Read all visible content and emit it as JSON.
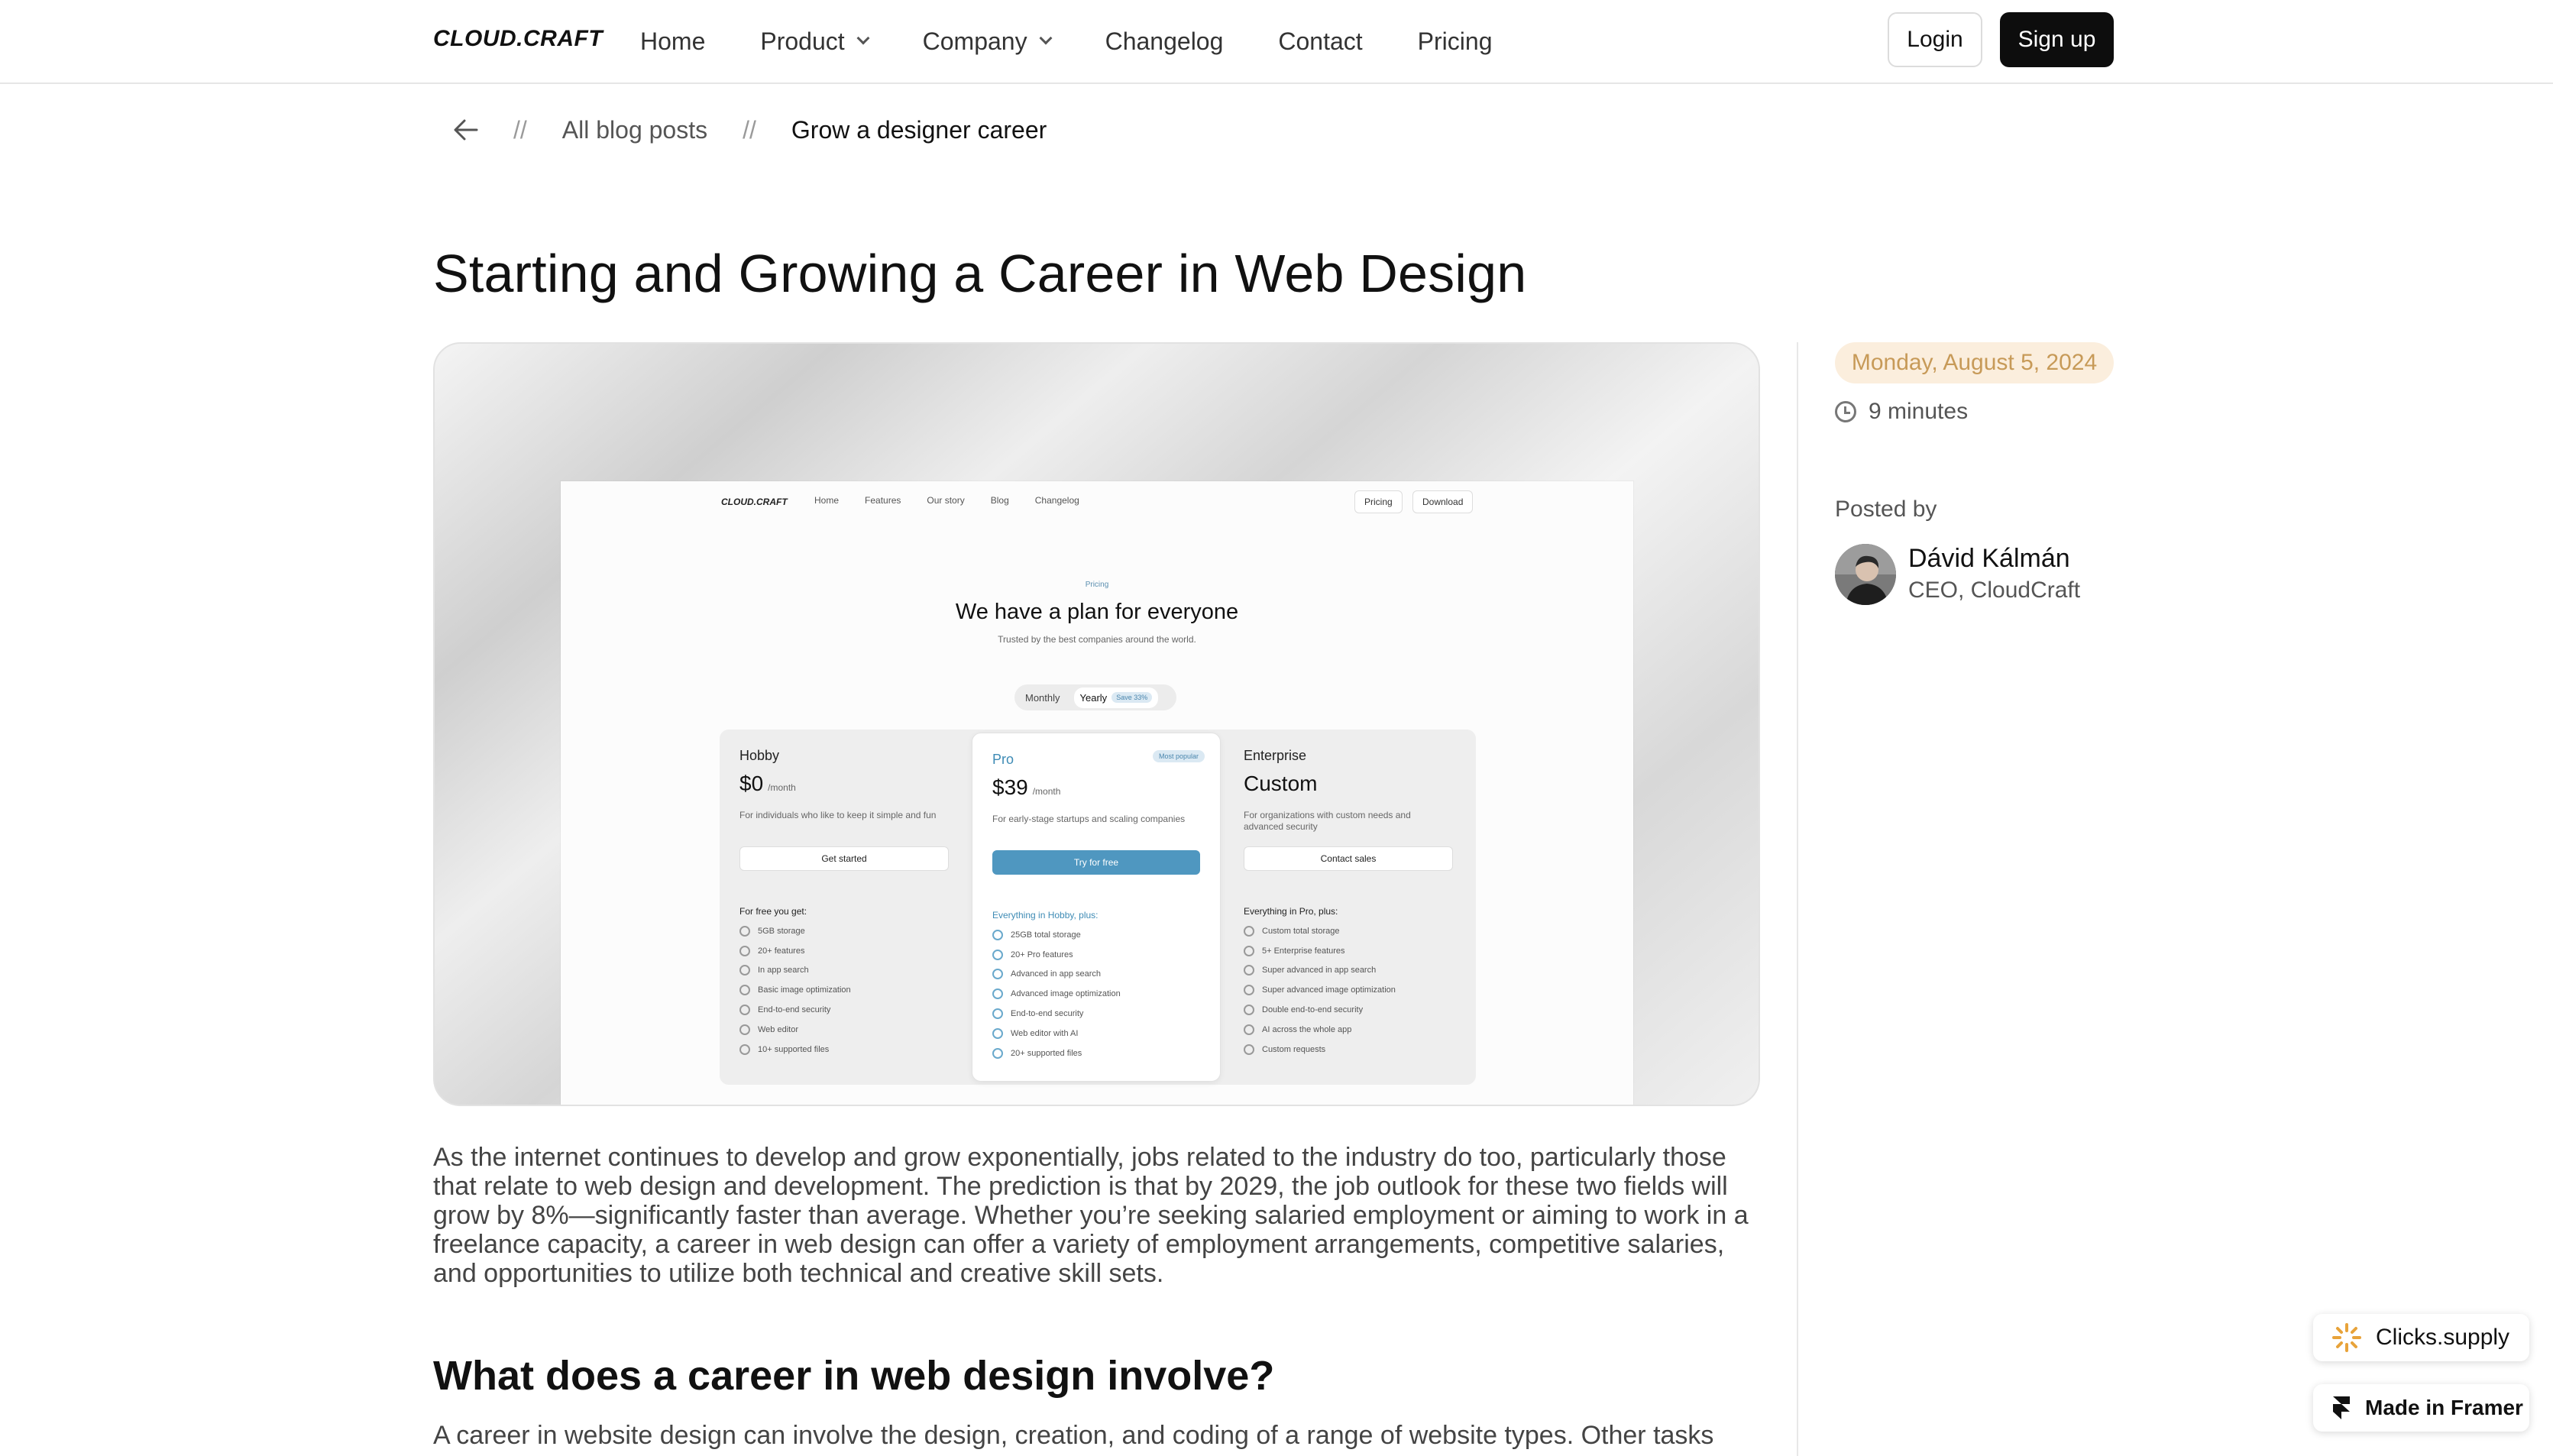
{
  "nav": {
    "logo": "CLOUD.CRAFT",
    "links": [
      {
        "label": "Home"
      },
      {
        "label": "Product"
      },
      {
        "label": "Company"
      },
      {
        "label": "Changelog"
      },
      {
        "label": "Contact"
      },
      {
        "label": "Pricing"
      }
    ],
    "login_label": "Login",
    "signup_label": "Sign up"
  },
  "breadcrumb": {
    "separator": "//",
    "all_posts": "All blog posts",
    "current": "Grow a designer career"
  },
  "article": {
    "title": "Starting and Growing a Career in Web Design",
    "intro": "As the internet continues to develop and grow exponentially, jobs related to the industry do too, particularly those that relate to web design and development. The prediction is that by 2029, the job outlook for these two fields will grow by 8%—significantly faster than average. Whether you’re seeking salaried employment or aiming to work in a freelance capacity, a career in web design can offer a variety of employment arrangements, competitive salaries, and opportunities to utilize both technical and creative skill sets.",
    "section_heading": "What does a career in web design involve?",
    "section_text": "A career in website design can involve the design, creation, and coding of a range of website types. Other tasks"
  },
  "hero_mock": {
    "logo": "CLOUD.CRAFT",
    "links": [
      "Home",
      "Features",
      "Our story",
      "Blog",
      "Changelog"
    ],
    "pricing_btn": "Pricing",
    "download_btn": "Download",
    "eyebrow": "Pricing",
    "heading": "We have a plan for everyone",
    "subheading": "Trusted by the best companies around the world.",
    "toggle": {
      "monthly": "Monthly",
      "yearly": "Yearly",
      "save": "Save 33%"
    },
    "plans": [
      {
        "name": "Hobby",
        "price": "$0",
        "period": "/month",
        "desc": "For individuals who like to keep it simple and fun",
        "button": "Get started",
        "features_head": "For free you get:",
        "features": [
          "5GB storage",
          "20+ features",
          "In app search",
          "Basic image optimization",
          "End-to-end security",
          "Web editor",
          "10+ supported files"
        ]
      },
      {
        "name": "Pro",
        "tag": "Most popular",
        "price": "$39",
        "period": "/month",
        "desc": "For early-stage startups and scaling companies",
        "button": "Try for free",
        "features_head": "Everything in Hobby, plus:",
        "features": [
          "25GB total storage",
          "20+ Pro features",
          "Advanced in app search",
          "Advanced image optimization",
          "End-to-end security",
          "Web editor with AI",
          "20+ supported files"
        ]
      },
      {
        "name": "Enterprise",
        "price": "Custom",
        "period": "",
        "desc": "For organizations with custom needs and advanced security",
        "button": "Contact sales",
        "features_head": "Everything in Pro, plus:",
        "features": [
          "Custom total storage",
          "5+ Enterprise features",
          "Super advanced in app search",
          "Super advanced image optimization",
          "Double end-to-end security",
          "AI across the whole app",
          "Custom requests"
        ]
      }
    ]
  },
  "sidebar": {
    "date": "Monday, August 5, 2024",
    "read_time": "9 minutes",
    "posted_by": "Posted by",
    "author_name": "Dávid Kálmán",
    "author_role": "CEO, CloudCraft"
  },
  "badges": {
    "clicks": "Clicks.supply",
    "framer": "Made in Framer"
  },
  "colors": {
    "accent_date_bg": "#fbeedd",
    "accent_date_text": "#c79a58",
    "signup_bg": "#0d0d0d",
    "mock_pro_blue": "#4f97c0"
  },
  "icons": {
    "back": "arrow-left-icon",
    "clock": "clock-icon",
    "clicks": "sparkle-icon",
    "framer": "framer-logo-icon"
  }
}
